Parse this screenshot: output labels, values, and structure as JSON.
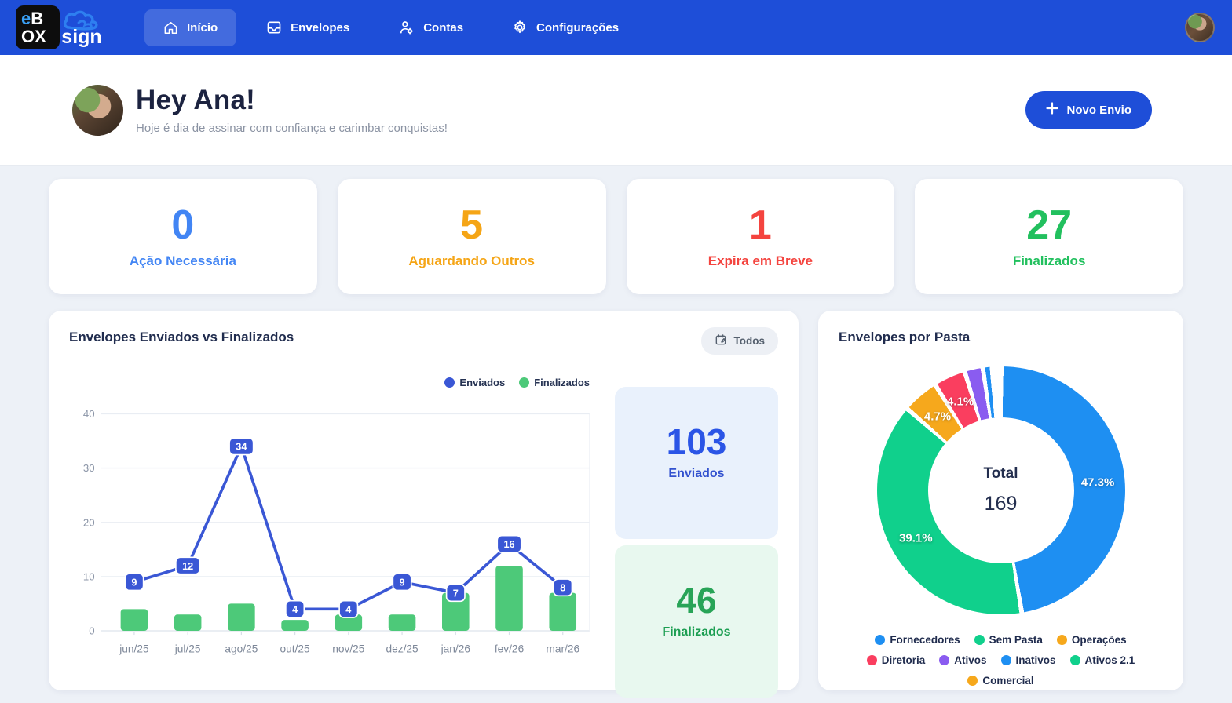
{
  "nav": {
    "logo": {
      "top_e": "e",
      "top_b": "B",
      "bottom": "OX",
      "brand": "sign"
    },
    "items": [
      {
        "label": "Início",
        "active": true
      },
      {
        "label": "Envelopes",
        "active": false
      },
      {
        "label": "Contas",
        "active": false
      },
      {
        "label": "Configurações",
        "active": false
      }
    ]
  },
  "hero": {
    "greeting": "Hey Ana!",
    "subtitle": "Hoje é dia de assinar com confiança e carimbar conquistas!",
    "new_button_label": "Novo Envio"
  },
  "stats": [
    {
      "value": "0",
      "label": "Ação Necessária",
      "color": "#4285f4"
    },
    {
      "value": "5",
      "label": "Aguardando Outros",
      "color": "#f5a516"
    },
    {
      "value": "1",
      "label": "Expira em Breve",
      "color": "#f4443f"
    },
    {
      "value": "27",
      "label": "Finalizados",
      "color": "#22c05e"
    }
  ],
  "left_panel": {
    "title": "Envelopes Enviados vs Finalizados",
    "filter_button": "Todos",
    "summary_cards": [
      {
        "value": "103",
        "label": "Enviados"
      },
      {
        "value": "46",
        "label": "Finalizados"
      }
    ]
  },
  "right_panel": {
    "title": "Envelopes por Pasta",
    "center_title": "Total",
    "center_value": "169"
  },
  "chart_data": [
    {
      "type": "bar",
      "subtype": "combo-bar-line",
      "title": "Envelopes Enviados vs Finalizados",
      "categories": [
        "jun/25",
        "jul/25",
        "ago/25",
        "out/25",
        "nov/25",
        "dez/25",
        "jan/26",
        "fev/26",
        "mar/26"
      ],
      "series": [
        {
          "name": "Enviados",
          "kind": "line",
          "color": "#3a57d5",
          "values": [
            9,
            12,
            34,
            4,
            4,
            9,
            7,
            16,
            8
          ]
        },
        {
          "name": "Finalizados",
          "kind": "bar",
          "color": "#4dc979",
          "values": [
            4,
            3,
            5,
            2,
            3,
            3,
            7,
            12,
            7
          ]
        }
      ],
      "ylim": [
        0,
        40
      ],
      "yticks": [
        0,
        10,
        20,
        30,
        40
      ],
      "legend_position": "top-right",
      "grid": true,
      "totals": {
        "enviados": 103,
        "finalizados": 46
      }
    },
    {
      "type": "pie",
      "subtype": "donut",
      "title": "Envelopes por Pasta",
      "total": 169,
      "center_label": "Total",
      "slices": [
        {
          "label": "Fornecedores",
          "value": 80,
          "pct_label": "47.3%",
          "color": "#1e8ff2"
        },
        {
          "label": "Sem Pasta",
          "value": 66,
          "pct_label": "39.1%",
          "color": "#10d08c"
        },
        {
          "label": "Operações",
          "value": 8,
          "pct_label": "4.7%",
          "color": "#f6a81c"
        },
        {
          "label": "Diretoria",
          "value": 7,
          "pct_label": "4.1%",
          "color": "#fa3e5f"
        },
        {
          "label": "Ativos",
          "value": 4,
          "pct_label": "",
          "color": "#8a5cf0"
        },
        {
          "label": "Inativos",
          "value": 2,
          "pct_label": "",
          "color": "#1e8ff2"
        },
        {
          "label": "Ativos 2.1",
          "value": 1,
          "pct_label": "",
          "color": "#10d08c"
        },
        {
          "label": "Comercial",
          "value": 1,
          "pct_label": "",
          "color": "#f6a81c"
        }
      ],
      "legend_position": "bottom"
    }
  ]
}
